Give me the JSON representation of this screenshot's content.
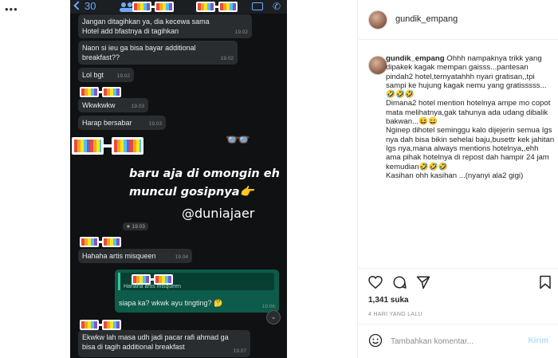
{
  "media": {
    "menu_dots": "•••",
    "whatsapp": {
      "back_count": "30",
      "messages": [
        {
          "text": "Jangan ditagihkan ya, dia kecewa sama\nHotel add bfastnya di tagihkan",
          "time": "19.02"
        },
        {
          "text": "Naon si ieu ga bisa bayar additional\nbreakfast??",
          "time": "19.02"
        },
        {
          "text": "Lol bgt",
          "time": "19.02"
        },
        {
          "text": "Wkwkwkw",
          "time": "19.03"
        },
        {
          "text": "Harap bersabar",
          "time": "19.03"
        },
        {
          "text": "Hahaha artis misqueen",
          "time": "19.04"
        },
        {
          "text": "Ekwkw lah masa udh jadi pacar rafi ahmad ga\nbisa di tagih additional breakfast",
          "time": "19.07"
        }
      ],
      "date_chip": "★ 19.03",
      "quote_label": "Hahaha artis misqueen",
      "reply_text": "siapa ka? wkwk ayu tingting? 🤔",
      "reply_time": "19.06"
    },
    "overlay_line1": "baru aja di omongin eh",
    "overlay_line2": "muncul gosipnya👉",
    "handle": "@duniajaer"
  },
  "header": {
    "username": "gundik_empang"
  },
  "caption": {
    "username": "gundik_empang",
    "text": "Ohhh nampaknya trikk yang dipakek kagak mempan gaisss...pantesan pindah2 hotel,ternyatahhh nyari gratisan,,tpi sampi ke hujung kagak nemu yang gratisssss...🤣🤣🤣\nDimana2 hotel mention hotelnya ampe mo copot mata melihatnya,gak tahunya ada udang dibalik bakwan...😆😄\nNginep dihotel seminggu kalo dijejerin semua Igs nya dah bisa bikin sehelai baju,busettr kek jahitan Igs nya,mana always mentions hotelnya,,ehh ama pihak hotelnya di repost dah hampir 24 jam kemudian🤣🤣🤣\nKasihan ohh kasihan ...(nyanyi ala2 gigi)"
  },
  "actions": {
    "likes": "1,341 suka",
    "time_ago": "4 HARI YANG LALU"
  },
  "comment": {
    "placeholder": "Tambahkan komentar...",
    "post_label": "Kirim"
  },
  "colors": {
    "phone_bg": "#0f1113",
    "bubble_bg": "#2a2d30",
    "reply_bubble_bg": "#0d5b4a",
    "wa_accent": "#6ea8ff",
    "post_disabled": "#b2dffc"
  }
}
